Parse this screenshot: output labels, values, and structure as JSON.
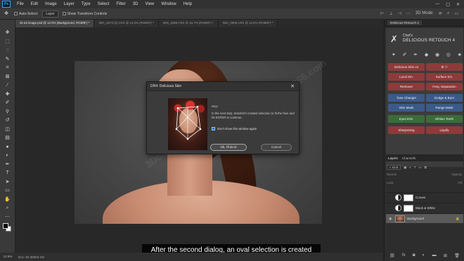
{
  "app": {
    "logo": "Ps",
    "menu": [
      "File",
      "Edit",
      "Image",
      "Layer",
      "Type",
      "Select",
      "Filter",
      "3D",
      "View",
      "Window",
      "Help"
    ],
    "window_controls": [
      "—",
      "▢",
      "✕"
    ]
  },
  "options_bar": {
    "auto_select_label": "Auto-Select:",
    "auto_select_value": "Layer",
    "transform_label": "Show Transform Controls",
    "mode_3d": "3D Mode:"
  },
  "tabs": [
    "ds tut image.psd @ 12.5% (Background, RGB/8*) *",
    "IMG_5673 (2).CR2 @ 12.5% (RGB/8*) *",
    "IMG_5388.CR2 @ 16.7% (RGB/8*) *",
    "IMG_0905.CR2 @ 12.5% (RGB/8*) *"
  ],
  "dialog": {
    "title": "DR4: Delicious Skin",
    "close": "✕",
    "greeting": "Hey!",
    "message": "In the next step, transform created selection to fit the face and hit ENTER to continue.",
    "checkbox_label": "Don't show this window again",
    "ok_label": "Ok, I'll do it!",
    "cancel_label": "Cancel"
  },
  "caption": "After the second dialog, an oval selection is created",
  "status": {
    "zoom": "12.5%",
    "doc": "Doc: 62.3M/63.1M"
  },
  "watermark": "3D66.com",
  "right_panel": {
    "tab": "Delicious Retouch 4",
    "brand_line1": "Chef's",
    "brand_line2": "DELICIOUS RETOUCH 4",
    "buttons": [
      {
        "label": "Delicious Skin v4",
        "color": "red"
      },
      {
        "label": "",
        "color": "red"
      },
      {
        "label": "Local Sm.",
        "color": "red"
      },
      {
        "label": "Surface Sm.",
        "color": "red"
      },
      {
        "label": "Remover",
        "color": "red"
      },
      {
        "label": "Freq. Separation",
        "color": "red"
      },
      {
        "label": "Tone Changer",
        "color": "blue"
      },
      {
        "label": "Dodge & Burn",
        "color": "blue"
      },
      {
        "label": "Skin Mask",
        "color": "blue"
      },
      {
        "label": "Range Mask",
        "color": "blue"
      },
      {
        "label": "Eyes Enh.",
        "color": "green"
      },
      {
        "label": "Whiten Teeth",
        "color": "green"
      },
      {
        "label": "Sharpening",
        "color": "red"
      },
      {
        "label": "Liquify",
        "color": "red"
      }
    ],
    "layers_tabs": [
      "Layers",
      "Channels"
    ],
    "filter_kind": "Kind",
    "blend_mode": "Normal",
    "opacity_label": "Opacity:",
    "lock_label": "Lock:",
    "fill_label": "Fill:",
    "layers": [
      "Curves",
      "Black & White",
      "Background"
    ]
  }
}
